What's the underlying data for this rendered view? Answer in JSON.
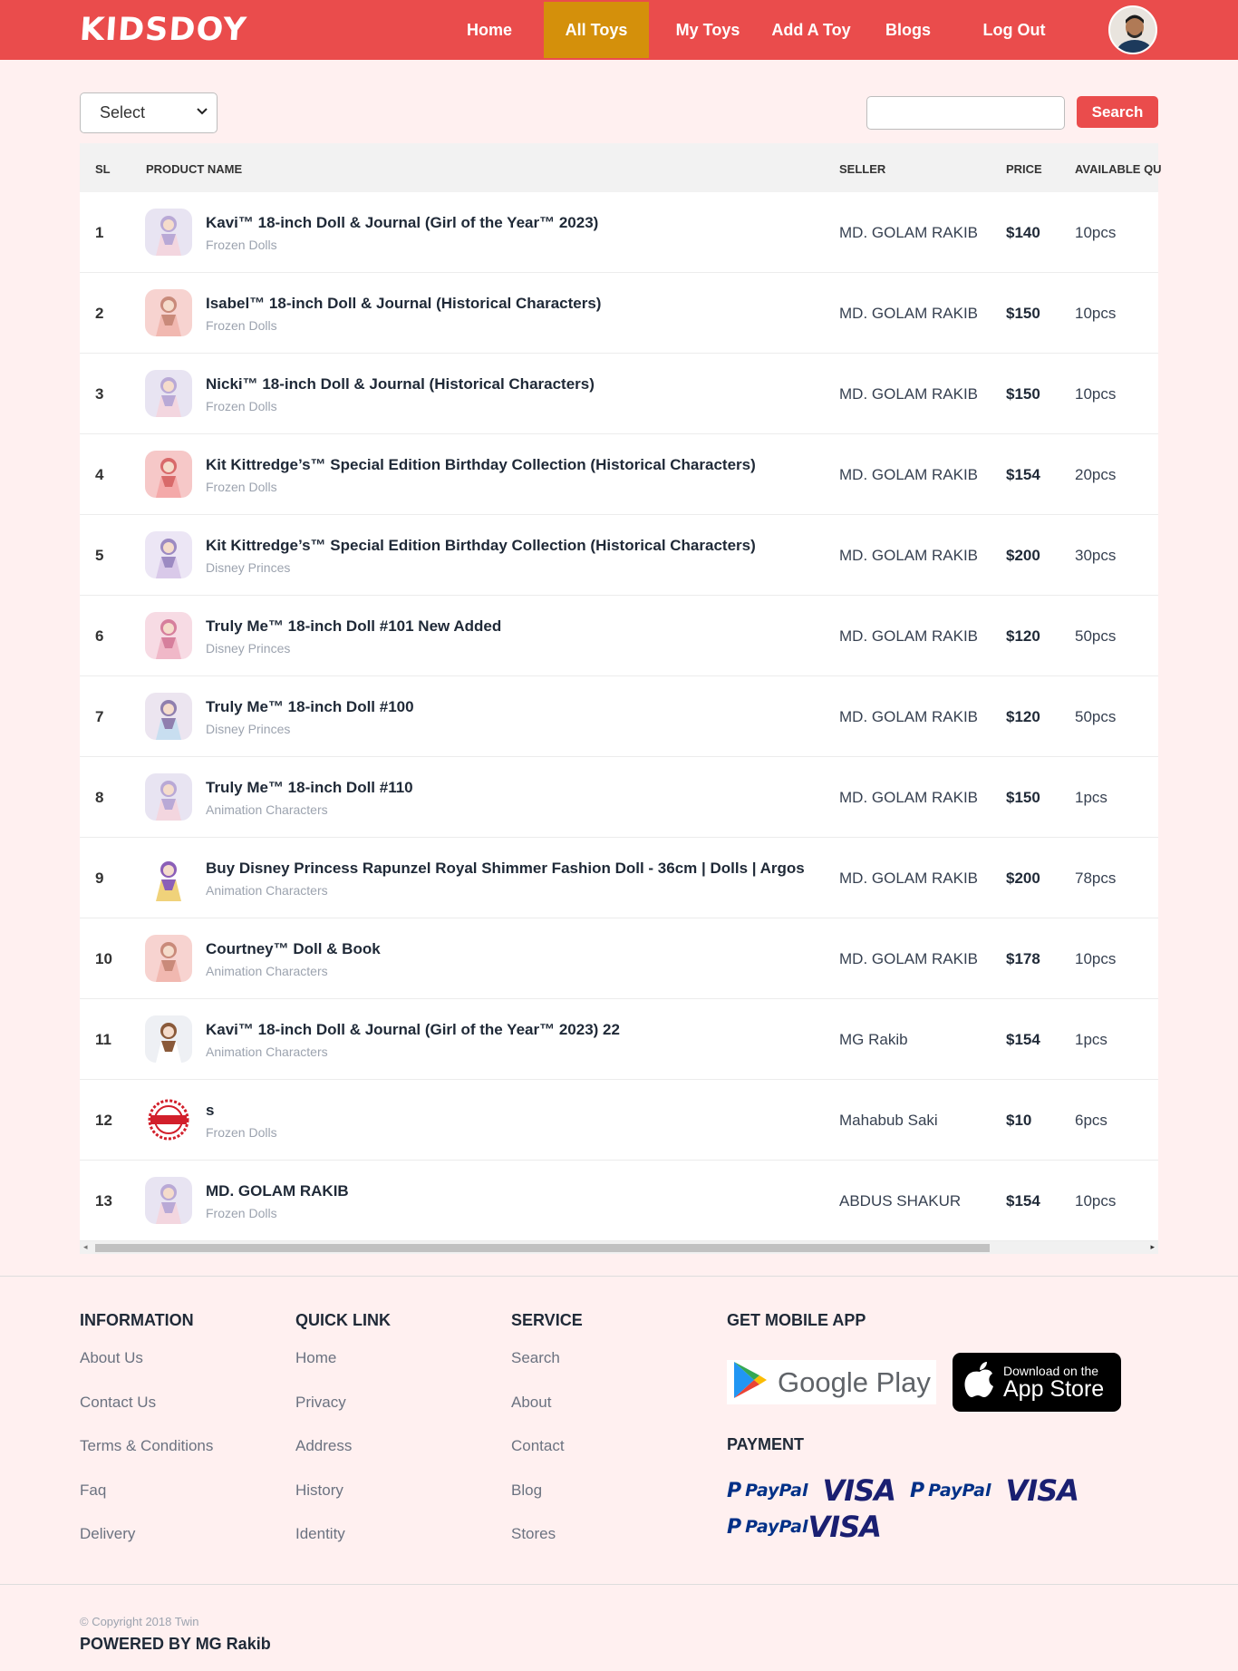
{
  "nav": {
    "logo": "KIDSDOY",
    "items": [
      {
        "label": "Home",
        "active": false
      },
      {
        "label": "All Toys",
        "active": true
      },
      {
        "label": "My Toys",
        "active": false
      },
      {
        "label": "Add A Toy",
        "active": false
      },
      {
        "label": "Blogs",
        "active": false
      },
      {
        "label": "Log Out",
        "active": false
      }
    ]
  },
  "controls": {
    "select_value": "Select",
    "search_value": "",
    "search_label": "Search"
  },
  "table": {
    "headers": [
      "SL",
      "PRODUCT NAME",
      "SELLER",
      "PRICE",
      "AVAILABLE QU"
    ],
    "rows": [
      {
        "sl": "1",
        "name": "Kavi™ 18-inch Doll & Journal (Girl of the Year™ 2023)",
        "category": "Frozen Dolls",
        "seller": "MD. GOLAM RAKIB",
        "price": "$140",
        "qty": "10pcs"
      },
      {
        "sl": "2",
        "name": "Isabel™ 18-inch Doll & Journal (Historical Characters)",
        "category": "Frozen Dolls",
        "seller": "MD. GOLAM RAKIB",
        "price": "$150",
        "qty": "10pcs"
      },
      {
        "sl": "3",
        "name": "Nicki™ 18-inch Doll & Journal (Historical Characters)",
        "category": "Frozen Dolls",
        "seller": "MD. GOLAM RAKIB",
        "price": "$150",
        "qty": "10pcs"
      },
      {
        "sl": "4",
        "name": "Kit Kittredge’s™ Special Edition Birthday Collection (Historical Characters)",
        "category": "Frozen Dolls",
        "seller": "MD. GOLAM RAKIB",
        "price": "$154",
        "qty": "20pcs"
      },
      {
        "sl": "5",
        "name": "Kit Kittredge’s™ Special Edition Birthday Collection (Historical Characters)",
        "category": "Disney Princes",
        "seller": "MD. GOLAM RAKIB",
        "price": "$200",
        "qty": "30pcs"
      },
      {
        "sl": "6",
        "name": "Truly Me™ 18-inch Doll #101 New Added",
        "category": "Disney Princes",
        "seller": "MD. GOLAM RAKIB",
        "price": "$120",
        "qty": "50pcs"
      },
      {
        "sl": "7",
        "name": "Truly Me™ 18-inch Doll #100",
        "category": "Disney Princes",
        "seller": "MD. GOLAM RAKIB",
        "price": "$120",
        "qty": "50pcs"
      },
      {
        "sl": "8",
        "name": "Truly Me™ 18-inch Doll #110",
        "category": "Animation Characters",
        "seller": "MD. GOLAM RAKIB",
        "price": "$150",
        "qty": "1pcs"
      },
      {
        "sl": "9",
        "name": "Buy Disney Princess Rapunzel Royal Shimmer Fashion Doll - 36cm | Dolls | Argos",
        "category": "Animation Characters",
        "seller": "MD. GOLAM RAKIB",
        "price": "$200",
        "qty": "78pcs"
      },
      {
        "sl": "10",
        "name": "Courtney™ Doll & Book",
        "category": "Animation Characters",
        "seller": "MD. GOLAM RAKIB",
        "price": "$178",
        "qty": "10pcs"
      },
      {
        "sl": "11",
        "name": "Kavi™ 18-inch Doll & Journal (Girl of the Year™ 2023) 22",
        "category": "Animation Characters",
        "seller": "MG Rakib",
        "price": "$154",
        "qty": "1pcs"
      },
      {
        "sl": "12",
        "name": "s",
        "category": "Frozen Dolls",
        "seller": "Mahabub Saki",
        "price": "$10",
        "qty": "6pcs"
      },
      {
        "sl": "13",
        "name": "MD. GOLAM RAKIB",
        "category": "Frozen Dolls",
        "seller": "ABDUS SHAKUR",
        "price": "$154",
        "qty": "10pcs"
      }
    ]
  },
  "footer": {
    "columns": [
      {
        "title": "INFORMATION",
        "links": [
          "About Us",
          "Contact Us",
          "Terms & Conditions",
          "Faq",
          "Delivery"
        ]
      },
      {
        "title": "QUICK LINK",
        "links": [
          "Home",
          "Privacy",
          "Address",
          "History",
          "Identity"
        ]
      },
      {
        "title": "SERVICE",
        "links": [
          "Search",
          "About",
          "Contact",
          "Blog",
          "Stores"
        ]
      }
    ],
    "app_title": "GET MOBILE APP",
    "google_play": "Google Play",
    "app_store_small": "Download on the",
    "app_store_big": "App Store",
    "payment_title": "PAYMENT",
    "payment_logos": [
      "PayPal",
      "VISA",
      "PayPal",
      "VISA",
      "PayPal",
      "VISA"
    ],
    "copyright": "© Copyright 2018 Twin",
    "powered": "POWERED BY MG Rakib"
  },
  "colors": {
    "brand": "#ea4c4c",
    "active_nav": "#d4900b",
    "page_bg": "#fff0f0"
  }
}
